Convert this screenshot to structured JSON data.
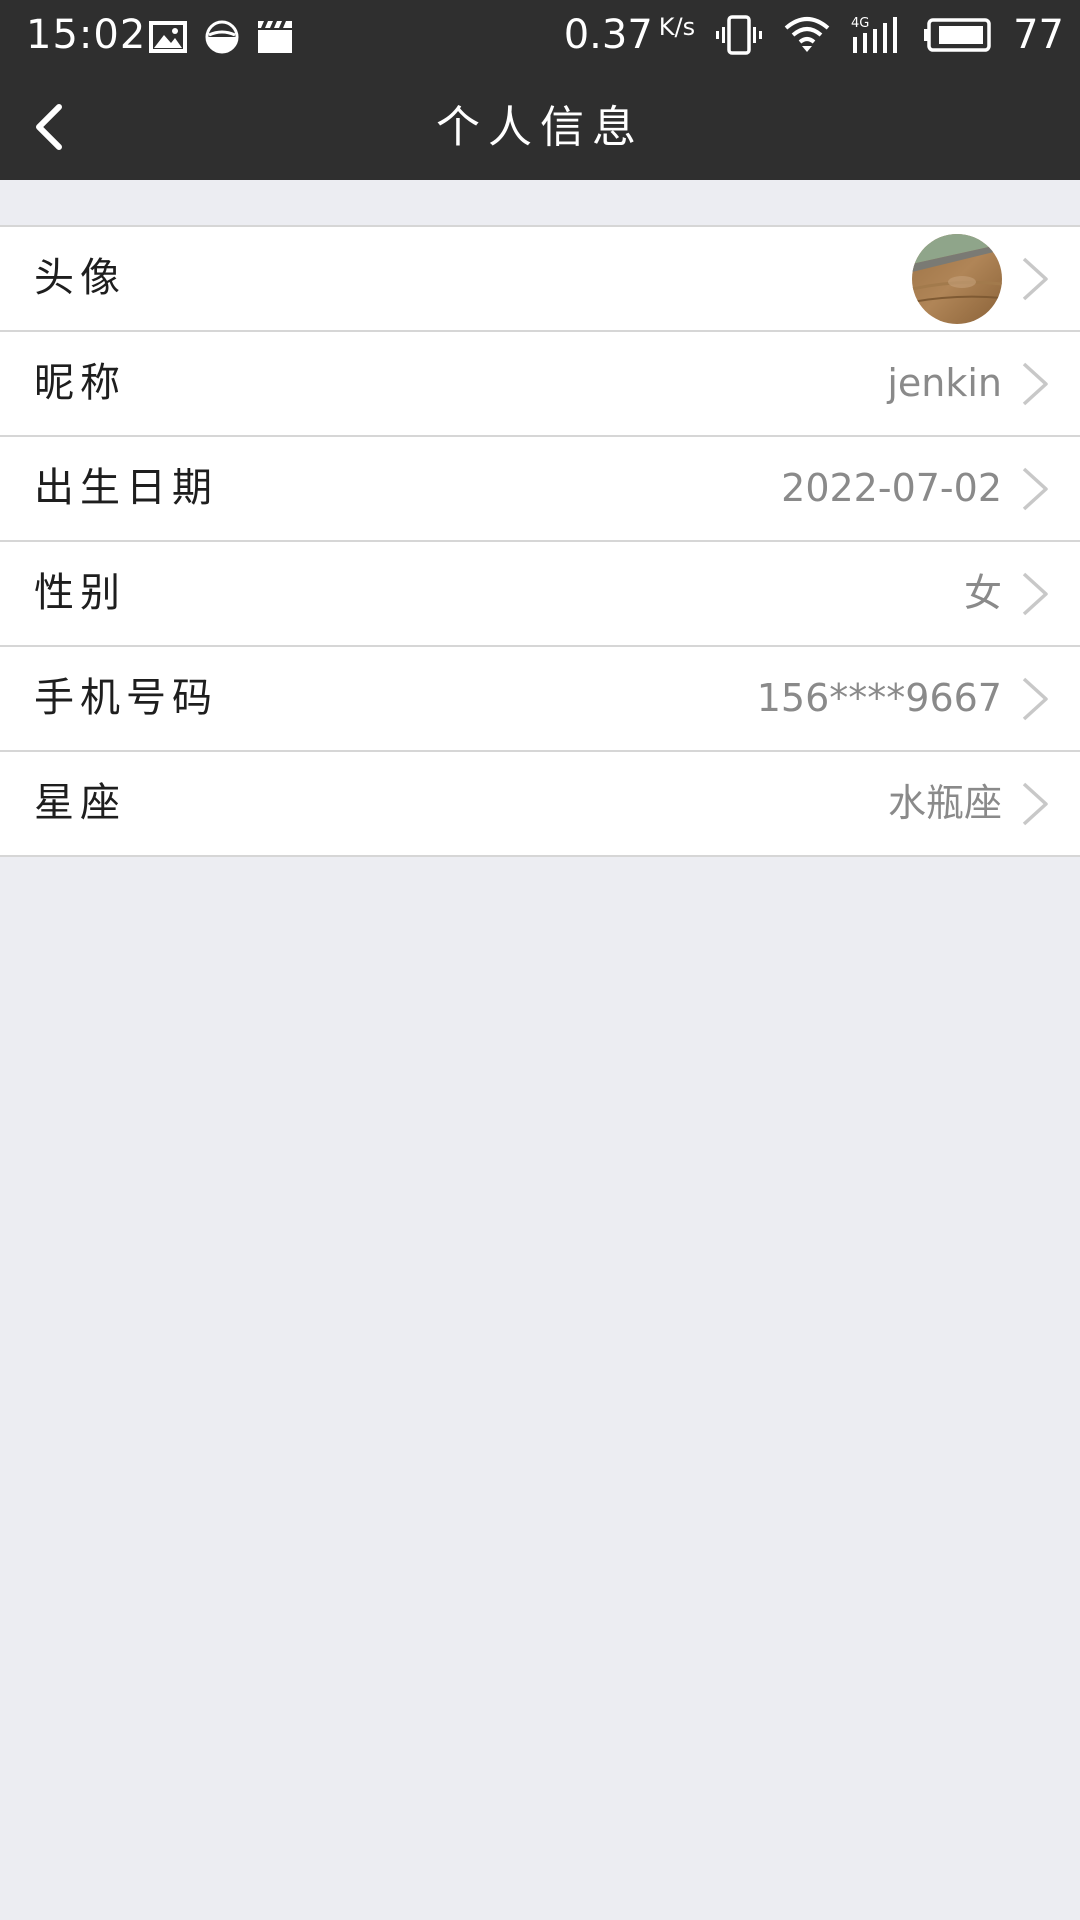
{
  "status_bar": {
    "time": "15:02",
    "net_speed": "0.37",
    "net_speed_unit": "K/s",
    "battery": "77",
    "icons": [
      "image-icon",
      "data-saver-icon",
      "clapperboard-icon",
      "vibrate-icon",
      "wifi-icon",
      "signal-4g-icon",
      "battery-icon"
    ]
  },
  "header": {
    "title": "个人信息",
    "back_icon": "chevron-left-icon"
  },
  "profile": {
    "rows": [
      {
        "label": "头像",
        "value": "",
        "type": "avatar"
      },
      {
        "label": "昵称",
        "value": "jenkin"
      },
      {
        "label": "出生日期",
        "value": "2022-07-02"
      },
      {
        "label": "性别",
        "value": "女"
      },
      {
        "label": "手机号码",
        "value": "156****9667"
      },
      {
        "label": "星座",
        "value": "水瓶座"
      }
    ],
    "chevron_icon": "chevron-right-icon"
  },
  "colors": {
    "bar_background": "#2f2f2f",
    "page_background": "#ecedf2",
    "divider": "#d6d6d6",
    "value_text": "#8a8a8a"
  }
}
